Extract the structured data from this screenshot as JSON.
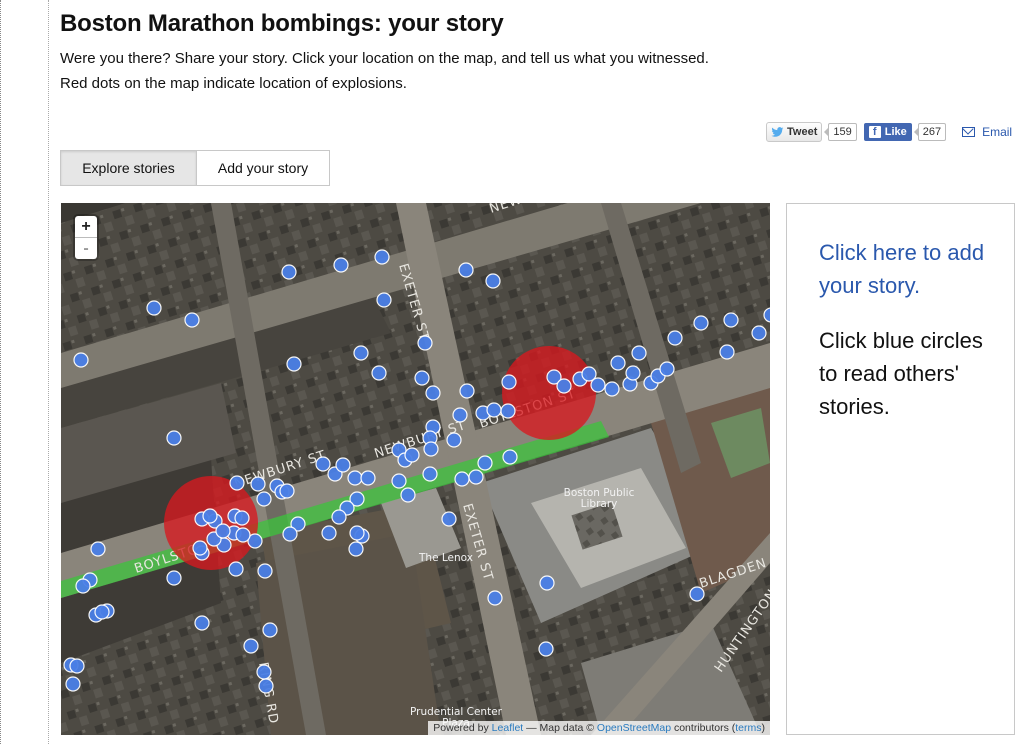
{
  "header": {
    "title": "Boston Marathon bombings: your story",
    "intro_line1": "Were you there? Share your story. Click your location on the map, and tell us what you witnessed.",
    "intro_line2": "Red dots on the map indicate location of explosions."
  },
  "share": {
    "tweet_label": "Tweet",
    "tweet_count": "159",
    "like_label": "Like",
    "like_count": "267",
    "email_label": "Email",
    "facebook_color": "#4267b2"
  },
  "tabs": [
    {
      "label": "Explore stories",
      "active": true
    },
    {
      "label": "Add your story",
      "active": false
    }
  ],
  "map": {
    "zoom_in": "+",
    "zoom_out": "-",
    "street_labels": [
      "NEWBURY ST",
      "NEWBURY ST",
      "EXETER ST",
      "EXETER ST",
      "BOYLSTON ST",
      "BOYLSTON ST",
      "RING RD",
      "HUNTINGTON AVE",
      "BLAGDEN ST",
      "NEWB"
    ],
    "place_labels": [
      "Boston Public Library",
      "The Lenox",
      "Prudential Center Plaza"
    ],
    "explosion_color": "#d9181f",
    "story_marker_color": "#4a7fe6",
    "marathon_route_color": "#3cc43c",
    "attribution": {
      "prefix": "Powered by",
      "leaflet": "Leaflet",
      "middle": "— Map data ©",
      "osm": "OpenStreetMap",
      "suffix": "contributors (",
      "terms": "terms",
      "close": ")"
    }
  },
  "sidebar": {
    "add_story_cta": "Click here to add your story.",
    "instructions": "Click blue circles to read others' stories."
  }
}
